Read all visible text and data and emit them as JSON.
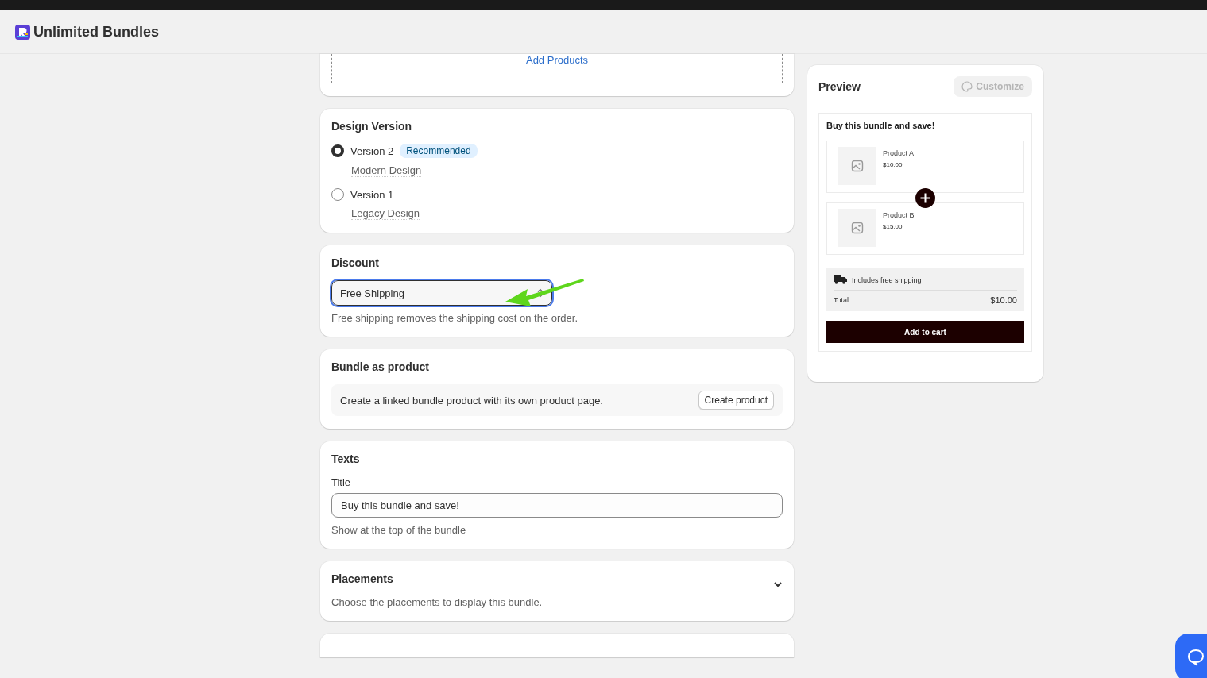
{
  "app": {
    "title": "Unlimited Bundles"
  },
  "products_card": {
    "link": "Add Products"
  },
  "design_version": {
    "title": "Design Version",
    "options": [
      {
        "label": "Version 2",
        "badge": "Recommended",
        "description": "Modern Design",
        "selected": true
      },
      {
        "label": "Version 1",
        "description": "Legacy Design",
        "selected": false
      }
    ]
  },
  "discount": {
    "title": "Discount",
    "value": "Free Shipping",
    "help": "Free shipping removes the shipping cost on the order."
  },
  "bundle_as_product": {
    "title": "Bundle as product",
    "text": "Create a linked bundle product with its own product page.",
    "button": "Create product"
  },
  "texts": {
    "title": "Texts",
    "label": "Title",
    "value": "Buy this bundle and save!",
    "help": "Show at the top of the bundle"
  },
  "placements": {
    "title": "Placements",
    "text": "Choose the placements to display this bundle.",
    "expanded": false
  },
  "preview": {
    "title": "Preview",
    "customize": "Customize",
    "customize_disabled": true,
    "widget_title": "Buy this bundle and save!",
    "products": [
      {
        "name": "Product A",
        "price": "$10.00"
      },
      {
        "name": "Product B",
        "price": "$15.00"
      }
    ],
    "shipping": "Includes free shipping",
    "total_label": "Total",
    "total": "$10.00",
    "cart_button": "Add to cart"
  }
}
